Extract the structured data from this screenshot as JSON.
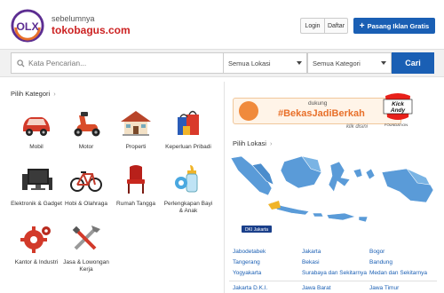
{
  "header": {
    "logo_text": "OLX",
    "tagline_small": "sebelumnya",
    "tagline_big": "tokobagus.com",
    "login_label": "Login",
    "daftar_label": "Daftar",
    "pasang_label": "Pasang Iklan Gratis",
    "pasang_icon": "plus-icon"
  },
  "search": {
    "placeholder": "Kata Pencarian...",
    "location_selected": "Semua Lokasi",
    "category_selected": "Semua Kategori",
    "submit_label": "Cari"
  },
  "categories": {
    "title": "Pilih Kategori",
    "items": [
      {
        "label": "Mobil",
        "icon": "car-icon"
      },
      {
        "label": "Motor",
        "icon": "scooter-icon"
      },
      {
        "label": "Properti",
        "icon": "house-icon"
      },
      {
        "label": "Keperluan Pribadi",
        "icon": "shopping-bag-icon"
      },
      {
        "label": "Elektronik & Gadget",
        "icon": "computer-icon"
      },
      {
        "label": "Hobi & Olahraga",
        "icon": "bicycle-icon"
      },
      {
        "label": "Rumah Tangga",
        "icon": "chair-icon"
      },
      {
        "label": "Perlengkapan Bayi & Anak",
        "icon": "baby-bottle-icon"
      },
      {
        "label": "Kantor & Industri",
        "icon": "gear-icon"
      },
      {
        "label": "Jasa & Lowongan Kerja",
        "icon": "tools-icon"
      }
    ]
  },
  "banner": {
    "sub": "dukung",
    "main": "#BekasJadiBerkah",
    "kick_line1": "Kick",
    "kick_line2": "Andy",
    "foundation": "FOUNDATION",
    "klik": "klik disini"
  },
  "locations": {
    "title": "Pilih Lokasi",
    "map_label": "DKI Jakarta",
    "rows": [
      [
        "Jabodetabek",
        "Jakarta",
        "Bogor"
      ],
      [
        "Tangerang",
        "Bekasi",
        "Bandung"
      ],
      [
        "Yogyakarta",
        "Surabaya dan Sekitarnya",
        "Medan dan Sekitarnya"
      ],
      [
        "Jakarta D.K.I.",
        "Jawa Barat",
        "Jawa Timur"
      ]
    ]
  },
  "colors": {
    "brand_blue": "#1a5fb4",
    "banner_orange": "#e8702a",
    "map_blue": "#5a9bd8"
  }
}
